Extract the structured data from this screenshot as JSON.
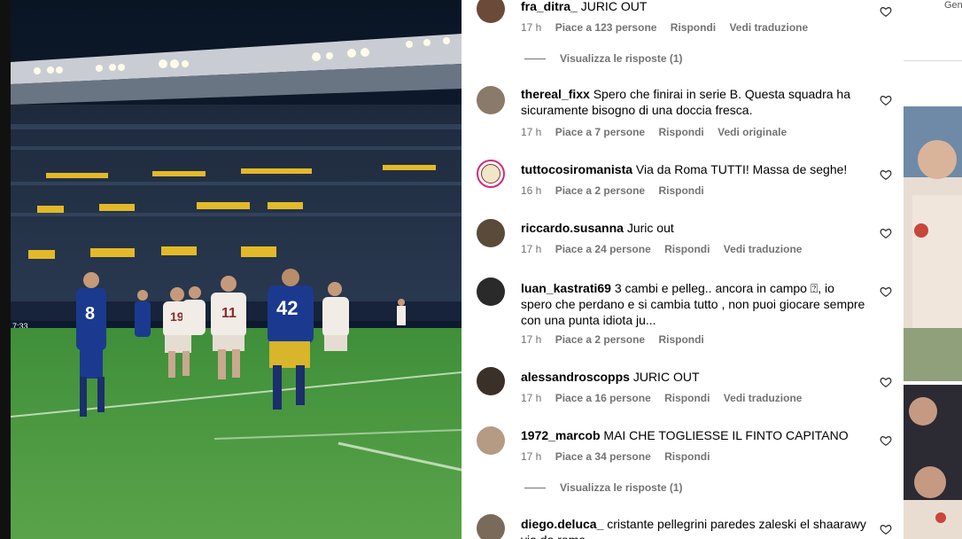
{
  "right_header_text": "Gen",
  "scoreboard_time": "7:33",
  "comments": [
    {
      "username": "fra_ditra_",
      "text": "JURIC OUT",
      "time": "17 h",
      "likes": "Piace a 123 persone",
      "reply": "Rispondi",
      "translate": "Vedi traduzione",
      "view_replies": "Visualizza le risposte (1)"
    },
    {
      "username": "thereal_fixx",
      "text": "Spero che finirai in serie B. Questa squadra ha sicuramente bisogno di una doccia fresca.",
      "time": "17 h",
      "likes": "Piace a 7 persone",
      "reply": "Rispondi",
      "translate": "Vedi originale"
    },
    {
      "username": "tuttocosiromanista",
      "text": "Via da Roma TUTTI! Massa de seghe!",
      "time": "16 h",
      "likes": "Piace a 2 persone",
      "reply": "Rispondi"
    },
    {
      "username": "riccardo.susanna",
      "text": "Juric out",
      "time": "17 h",
      "likes": "Piace a 24 persone",
      "reply": "Rispondi",
      "translate": "Vedi traduzione"
    },
    {
      "username": "luan_kastrati69",
      "text": "3 cambi e pelleg.. ancora in campo ⍰, io spero che perdano e si cambia tutto , non puoi giocare sempre con una punta idiota ju...",
      "time": "17 h",
      "likes": "Piace a 2 persone",
      "reply": "Rispondi"
    },
    {
      "username": "alessandroscopps",
      "text": "JURIC OUT",
      "time": "17 h",
      "likes": "Piace a 16 persone",
      "reply": "Rispondi",
      "translate": "Vedi traduzione"
    },
    {
      "username": "1972_marcob",
      "text": "MAI CHE TOGLIESSE IL FINTO CAPITANO",
      "time": "17 h",
      "likes": "Piace a 34 persone",
      "reply": "Rispondi",
      "view_replies": "Visualizza le risposte (1)"
    },
    {
      "username": "diego.deluca_",
      "text": "cristante pellegrini paredes zaleski el shaarawy via da roma",
      "time": "",
      "likes": "",
      "reply": ""
    }
  ],
  "players": [
    {
      "number": "8"
    },
    {
      "number": "42"
    },
    {
      "number": "19"
    },
    {
      "number": "11"
    }
  ],
  "colors": {
    "meta_gray": "#737373",
    "verona_blue": "#1b3a8f",
    "roma_white": "#f1ece6"
  }
}
